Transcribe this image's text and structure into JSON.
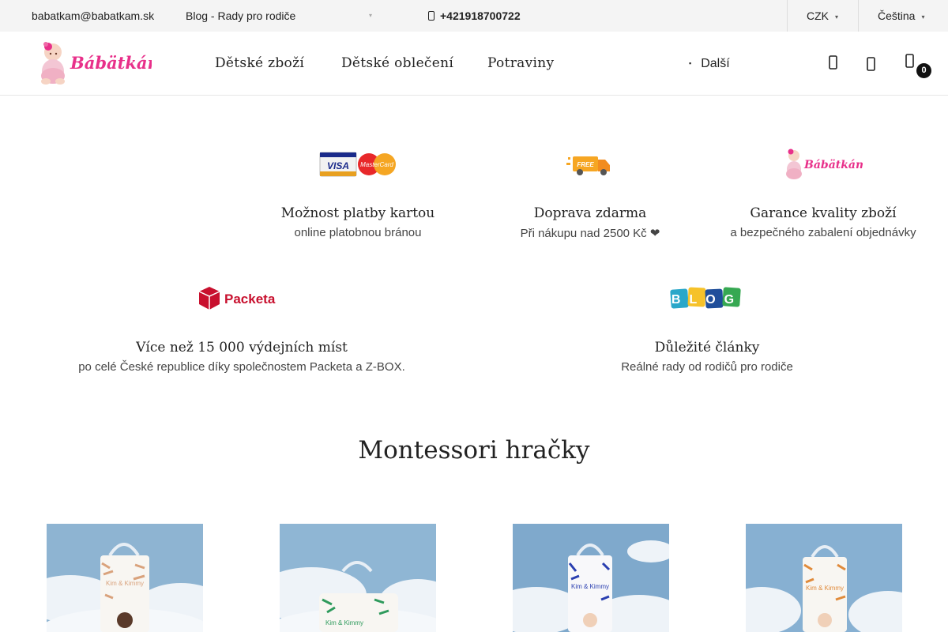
{
  "topbar": {
    "email": "babatkam@babatkam.sk",
    "blog": "Blog - Rady pro rodiče",
    "phone": "+421918700722",
    "currency": "CZK",
    "language": "Čeština"
  },
  "header": {
    "logo_text": "Bábätkám",
    "nav": [
      "Dětské zboží",
      "Dětské oblečení",
      "Potraviny"
    ],
    "more_label": "Další",
    "cart_count": "0"
  },
  "benefits": [
    {
      "title": "Možnost platby kartou",
      "subtitle": "online platobnou bránou",
      "icon": "visa-mastercard-icon",
      "icon_text_1": "VISA",
      "icon_text_2": "MasterCard"
    },
    {
      "title": "Doprava zdarma",
      "subtitle": "Při nákupu nad 2500 Kč ❤",
      "icon": "free-delivery-truck-icon",
      "icon_text": "FREE"
    },
    {
      "title": "Garance kvality zboží",
      "subtitle": "a bezpečného zabalení objednávky",
      "icon": "babatkam-logo-icon"
    },
    {
      "title": "Více než 15 000 výdejních míst",
      "subtitle": "po celé České republice díky společnostem Packeta a Z-BOX.",
      "icon": "packeta-icon",
      "icon_text": "Packeta"
    },
    {
      "title": "Důležité články",
      "subtitle": "Reálné rady od rodičů pro rodiče",
      "icon": "blog-icon",
      "icon_text": "BLOG"
    }
  ],
  "section_title": "Montessori hračky",
  "products": [
    {
      "brand": "Kim & Kimmy",
      "accent": "#d9a27c"
    },
    {
      "brand": "Kim & Kimmy",
      "accent": "#2e9a5c"
    },
    {
      "brand": "Kim & Kimmy",
      "accent": "#2a3fb0"
    },
    {
      "brand": "Kim & Kimmy",
      "accent": "#e08a3a"
    }
  ],
  "colors": {
    "topbar_bg": "#f4f4f4",
    "brand_pink": "#e8308a",
    "packeta_red": "#c8102e"
  }
}
